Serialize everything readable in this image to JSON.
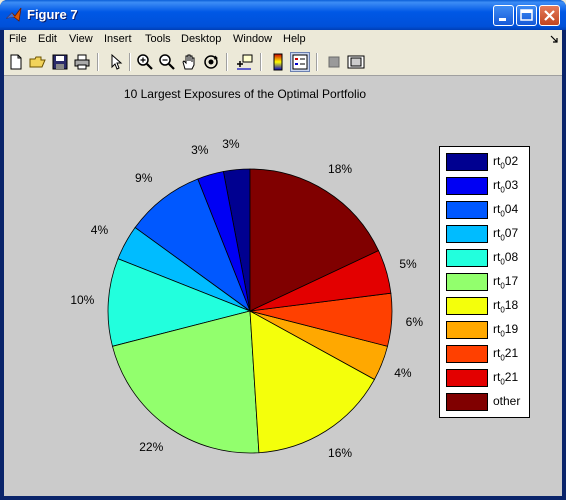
{
  "window": {
    "title": "Figure 7"
  },
  "menu": [
    "File",
    "Edit",
    "View",
    "Insert",
    "Tools",
    "Desktop",
    "Window",
    "Help"
  ],
  "toolbar": [
    "new-file-icon",
    "open-folder-icon",
    "save-icon",
    "print-icon",
    "pointer-icon",
    "zoom-in-icon",
    "zoom-out-icon",
    "pan-hand-icon",
    "rotate-3d-icon",
    "data-cursor-icon",
    "colorbar-icon",
    "legend-icon",
    "hide-plot-tools-icon",
    "show-plot-tools-icon"
  ],
  "chart_data": {
    "type": "pie",
    "title": "10 Largest Exposures of  the Optimal Portfolio",
    "labels": [
      "rt02",
      "rt03",
      "rt04",
      "rt07",
      "rt08",
      "rt17",
      "rt18",
      "rt19",
      "rt21",
      "rt21",
      "other"
    ],
    "legend": [
      {
        "prefix": "rt",
        "sub": "0",
        "suffix": "02",
        "color": "#000090"
      },
      {
        "prefix": "rt",
        "sub": "0",
        "suffix": "03",
        "color": "#0000f4"
      },
      {
        "prefix": "rt",
        "sub": "0",
        "suffix": "04",
        "color": "#0058ff"
      },
      {
        "prefix": "rt",
        "sub": "0",
        "suffix": "07",
        "color": "#00bcff"
      },
      {
        "prefix": "rt",
        "sub": "0",
        "suffix": "08",
        "color": "#22ffdd"
      },
      {
        "prefix": "rt",
        "sub": "0",
        "suffix": "17",
        "color": "#92ff6d"
      },
      {
        "prefix": "rt",
        "sub": "0",
        "suffix": "18",
        "color": "#f4ff0b"
      },
      {
        "prefix": "rt",
        "sub": "0",
        "suffix": "19",
        "color": "#ffa800"
      },
      {
        "prefix": "rt",
        "sub": "0",
        "suffix": "21",
        "color": "#ff4000"
      },
      {
        "prefix": "rt",
        "sub": "0",
        "suffix": "21",
        "color": "#e30000"
      },
      {
        "prefix": "",
        "sub": "",
        "suffix": "other",
        "color": "#800000"
      }
    ],
    "values": [
      3,
      3,
      9,
      4,
      10,
      22,
      16,
      4,
      6,
      5,
      18
    ],
    "value_labels": [
      "3%",
      "3%",
      "9%",
      "4%",
      "10%",
      "22%",
      "16%",
      "4%",
      "6%",
      "5%",
      "18%"
    ],
    "colors": [
      "#000090",
      "#0000f4",
      "#0058ff",
      "#00bcff",
      "#22ffdd",
      "#92ff6d",
      "#f4ff0b",
      "#ffa800",
      "#ff4000",
      "#e30000",
      "#800000"
    ],
    "start": "top",
    "direction": "counterclockwise",
    "legend_position": "right"
  }
}
